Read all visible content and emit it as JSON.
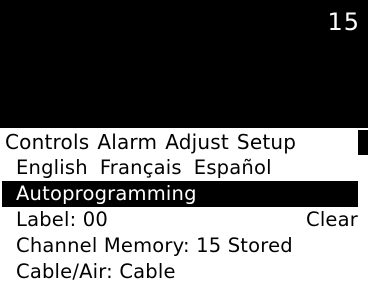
{
  "screen": {
    "channel": "15"
  },
  "menu": {
    "tabs": [
      {
        "label": "Controls"
      },
      {
        "label": "Alarm"
      },
      {
        "label": "Adjust"
      },
      {
        "label": "Setup"
      }
    ]
  },
  "setup": {
    "languages": [
      "English",
      "Français",
      "Español"
    ],
    "autoprogramming": "Autoprogramming",
    "label": {
      "text": "Label: 00",
      "action": "Clear"
    },
    "channel_memory": "Channel Memory: 15 Stored",
    "cable_air": "Cable/Air: Cable"
  },
  "colors": {
    "background": "#ffffff",
    "video": "#000000",
    "highlight": "#000000",
    "highlight_text": "#ffffff"
  }
}
